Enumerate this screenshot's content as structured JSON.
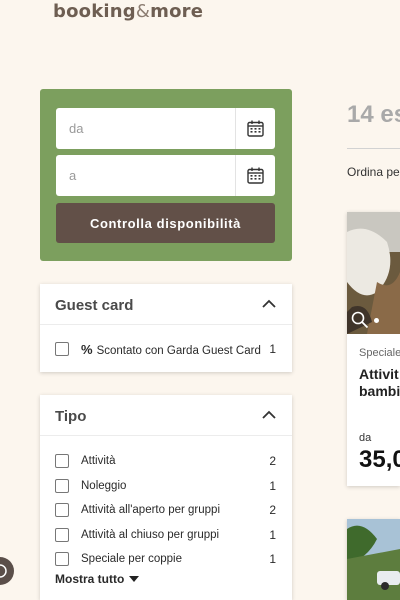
{
  "brand": {
    "name": "booking",
    "amp": "&",
    "suffix": "more"
  },
  "search": {
    "from_placeholder": "da",
    "to_placeholder": "a",
    "check_label": "Controlla disponibilità"
  },
  "guest_card": {
    "title": "Guest card",
    "items": [
      {
        "label": "Scontato con Garda Guest Card",
        "count": "1",
        "icon": "%"
      }
    ]
  },
  "tipo": {
    "title": "Tipo",
    "items": [
      {
        "label": "Attività",
        "count": "2"
      },
      {
        "label": "Noleggio",
        "count": "1"
      },
      {
        "label": "Attività all'aperto per gruppi",
        "count": "2"
      },
      {
        "label": "Attività al chiuso per gruppi",
        "count": "1"
      },
      {
        "label": "Speciale per coppie",
        "count": "1"
      }
    ],
    "show_all": "Mostra tutto"
  },
  "results": {
    "title": "14 es",
    "sort_label": "Ordina per"
  },
  "offer": {
    "category": "Speciale",
    "title_line1": "Attivit",
    "title_line2": "bambin",
    "from_label": "da",
    "price": "35,0"
  },
  "colors": {
    "background": "#fcf6ee",
    "search_box": "#7c9f5e",
    "button": "#625048",
    "brand": "#6e5e52"
  },
  "icons": {
    "calendar": "calendar-icon",
    "chevron_up": "chevron-up-icon",
    "caret_down": "caret-down-icon",
    "zoom": "zoom-icon",
    "help": "help-icon"
  }
}
